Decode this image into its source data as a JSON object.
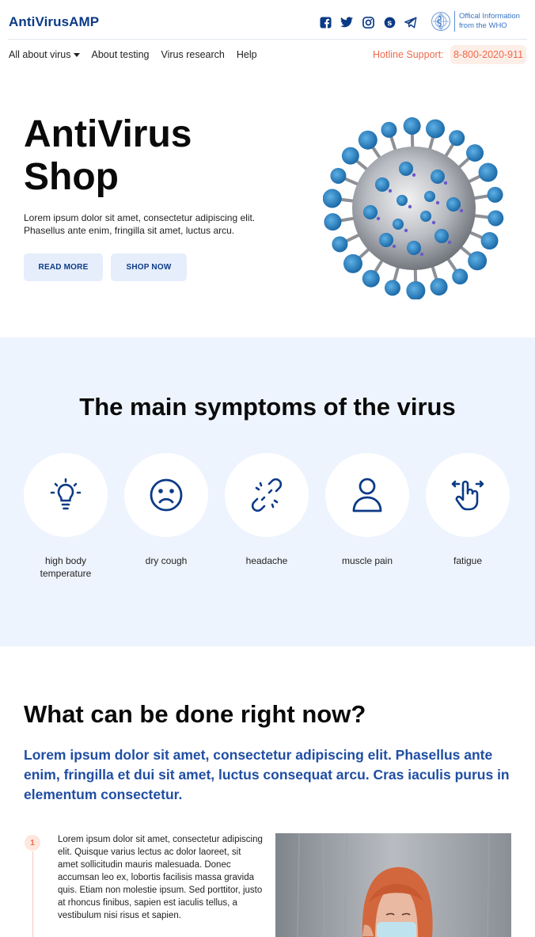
{
  "header": {
    "brand": "AntiVirusAMP",
    "social_icons": [
      "facebook-icon",
      "twitter-icon",
      "instagram-icon",
      "skype-icon",
      "telegram-icon"
    ],
    "who_text": "Offical Information from the WHO"
  },
  "nav": {
    "items": [
      {
        "label": "All about virus",
        "has_dropdown": true
      },
      {
        "label": "About testing"
      },
      {
        "label": "Virus research"
      },
      {
        "label": "Help"
      }
    ],
    "hotline_label": "Hotline Support:",
    "hotline_number": "8-800-2020-911"
  },
  "hero": {
    "title": "AntiVirus Shop",
    "text": "Lorem ipsum dolor sit amet, consectetur adipiscing elit. Phasellus ante enim, fringilla sit amet, luctus arcu.",
    "read_more": "READ MORE",
    "shop_now": "SHOP NOW"
  },
  "symptoms": {
    "title": "The main symptoms of the virus",
    "items": [
      {
        "label": "high body temperature",
        "icon": "lightbulb-icon"
      },
      {
        "label": "dry cough",
        "icon": "sad-face-icon"
      },
      {
        "label": "headache",
        "icon": "broken-link-icon"
      },
      {
        "label": "muscle pain",
        "icon": "person-icon"
      },
      {
        "label": "fatigue",
        "icon": "swipe-hand-icon"
      }
    ]
  },
  "done": {
    "title": "What can be done right now?",
    "lead": "Lorem ipsum dolor sit amet, consectetur adipiscing elit. Phasellus ante enim, fringilla et dui sit amet, luctus consequat arcu. Cras iaculis purus in elementum consectetur.",
    "steps": [
      {
        "num": "1",
        "text": "Lorem ipsum dolor sit amet, consectetur adipiscing elit. Quisque varius lectus ac dolor laoreet, sit amet sollicitudin mauris malesuada. Donec accumsan leo ex, lobortis facilisis massa gravida quis. Etiam non molestie ipsum. Sed porttitor, justo at rhoncus finibus, sapien est iaculis tellus, a vestibulum nisi risus et sapien."
      }
    ]
  },
  "colors": {
    "brand": "#0b3a86",
    "accent_orange": "#ef6a4c",
    "symptoms_bg": "#eef4fe",
    "button_bg": "#e6eefc"
  }
}
